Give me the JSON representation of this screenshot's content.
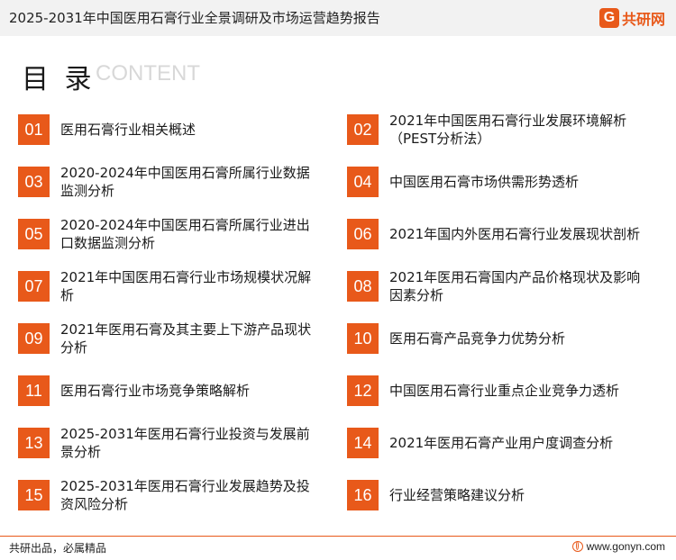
{
  "header": {
    "title": "2025-2031年中国医用石膏行业全景调研及市场运营趋势报告",
    "logo_mark": "G",
    "logo_text": "共研网"
  },
  "section": {
    "title": "目 录",
    "subtitle": "CONTENT"
  },
  "toc": [
    {
      "num": "01",
      "label": "医用石膏行业相关概述"
    },
    {
      "num": "02",
      "label": "2021年中国医用石膏行业发展环境解析（PEST分析法）"
    },
    {
      "num": "03",
      "label": "2020-2024年中国医用石膏所属行业数据监测分析"
    },
    {
      "num": "04",
      "label": "中国医用石膏市场供需形势透析"
    },
    {
      "num": "05",
      "label": "2020-2024年中国医用石膏所属行业进出口数据监测分析"
    },
    {
      "num": "06",
      "label": "2021年国内外医用石膏行业发展现状剖析"
    },
    {
      "num": "07",
      "label": "2021年中国医用石膏行业市场规模状况解析"
    },
    {
      "num": "08",
      "label": "2021年医用石膏国内产品价格现状及影响因素分析"
    },
    {
      "num": "09",
      "label": "2021年医用石膏及其主要上下游产品现状分析"
    },
    {
      "num": "10",
      "label": "医用石膏产品竞争力优势分析"
    },
    {
      "num": "11",
      "label": "医用石膏行业市场竞争策略解析"
    },
    {
      "num": "12",
      "label": "中国医用石膏行业重点企业竞争力透析"
    },
    {
      "num": "13",
      "label": "2025-2031年医用石膏行业投资与发展前景分析"
    },
    {
      "num": "14",
      "label": "2021年医用石膏产业用户度调查分析"
    },
    {
      "num": "15",
      "label": "2025-2031年医用石膏行业发展趋势及投资风险分析"
    },
    {
      "num": "16",
      "label": "行业经营策略建议分析"
    }
  ],
  "footer": {
    "slogan": "共研出品，必属精品",
    "url": "www.gonyn.com"
  },
  "colors": {
    "accent": "#e8591a",
    "header_bg": "#f2f2f2",
    "subtitle_gray": "#d8d8d8"
  }
}
